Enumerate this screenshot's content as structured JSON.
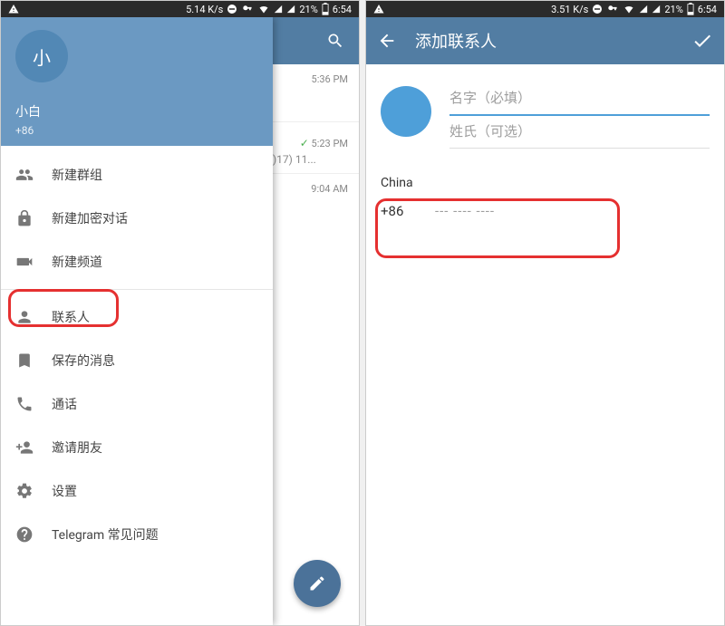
{
  "status": {
    "left_speed": "5.14 K/s",
    "right_speed": "3.51 K/s",
    "battery": "21%",
    "time": "6:54"
  },
  "drawer": {
    "avatar_letter": "小",
    "profile_name": "小白",
    "profile_phone": "+86",
    "items": [
      {
        "icon": "group",
        "label": "新建群组"
      },
      {
        "icon": "lock",
        "label": "新建加密对话"
      },
      {
        "icon": "megaphone",
        "label": "新建频道"
      },
      {
        "icon": "contacts",
        "label": "联系人"
      },
      {
        "icon": "bookmark",
        "label": "保存的消息"
      },
      {
        "icon": "phone",
        "label": "通话"
      },
      {
        "icon": "invite",
        "label": "邀请朋友"
      },
      {
        "icon": "settings",
        "label": "设置"
      },
      {
        "icon": "help",
        "label": "Telegram 常见问题"
      }
    ]
  },
  "chat_fragments": {
    "time1": "5:36 PM",
    "time2": "5:23 PM",
    "sub2": ")17) 11...",
    "time3": "9:04 AM"
  },
  "add_contact": {
    "title": "添加联系人",
    "first_placeholder": "名字（必填）",
    "last_placeholder": "姓氏（可选）",
    "country": "China",
    "code": "+86",
    "phone_hint": "--- ---- ----"
  }
}
